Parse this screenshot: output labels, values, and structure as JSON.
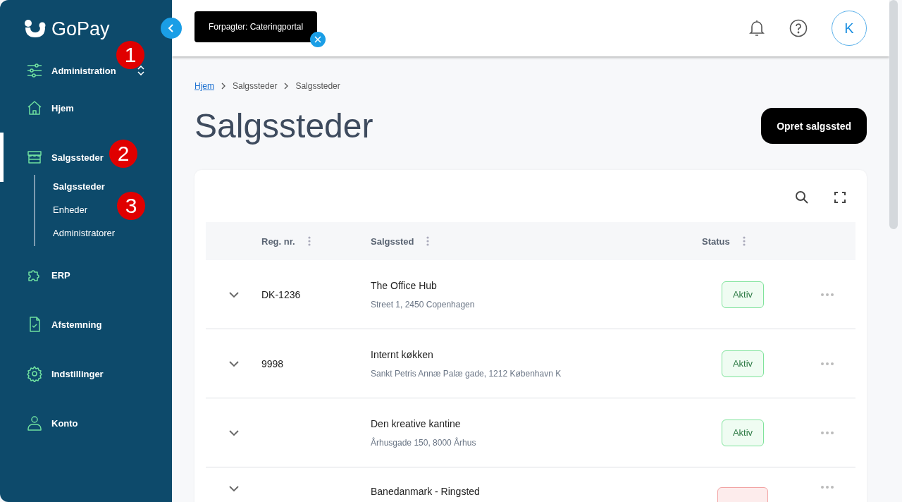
{
  "sidebar": {
    "logo": "GoPay",
    "switcher": {
      "label": "Administration"
    },
    "items": [
      {
        "label": "Hjem",
        "selected": false
      },
      {
        "label": "Salgssteder",
        "selected": true,
        "children": [
          {
            "label": "Salgssteder",
            "selected": true
          },
          {
            "label": "Enheder",
            "selected": false
          },
          {
            "label": "Administratorer",
            "selected": false
          }
        ]
      },
      {
        "label": "ERP",
        "selected": false
      },
      {
        "label": "Afstemning",
        "selected": false
      },
      {
        "label": "Indstillinger",
        "selected": false
      },
      {
        "label": "Konto",
        "selected": false
      }
    ]
  },
  "annotations": [
    {
      "text": "1"
    },
    {
      "text": "2"
    },
    {
      "text": "3"
    }
  ],
  "header": {
    "tenant_chip": "Forpagter: Cateringportal",
    "avatar": "K"
  },
  "breadcrumb": [
    "Hjem",
    "Salgssteder",
    "Salgssteder"
  ],
  "page_title": "Salgssteder",
  "primary_button": "Opret salgssted",
  "table": {
    "columns": [
      "Reg. nr.",
      "Salgssted",
      "Status"
    ],
    "rows": [
      {
        "reg": "DK-1236",
        "name": "The Office Hub",
        "address": "Street 1, 2450 Copenhagen",
        "status": "Aktiv",
        "active": true
      },
      {
        "reg": "9998",
        "name": "Internt køkken",
        "address": "Sankt Petris Annæ Palæ gade, 1212 København K",
        "status": "Aktiv",
        "active": true
      },
      {
        "name": "Den kreative kantine",
        "address": "Århusgade 150, 8000 Århus",
        "status": "Aktiv",
        "active": true
      },
      {
        "name": "Banedanmark - Ringsted",
        "active": false
      }
    ]
  }
}
